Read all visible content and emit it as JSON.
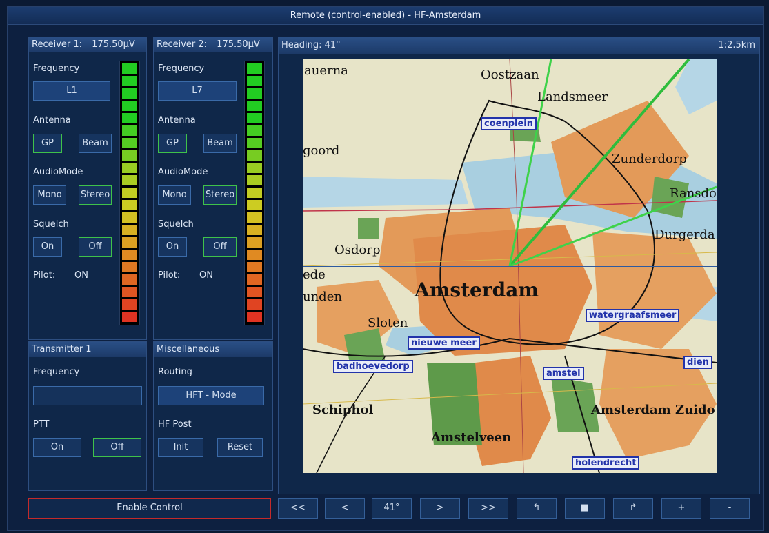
{
  "window": {
    "title": "Remote (control-enabled) - HF-Amsterdam"
  },
  "receiver1": {
    "title": "Receiver 1:",
    "level": "175.50µV",
    "frequency_label": "Frequency",
    "frequency_value": "L1",
    "antenna_label": "Antenna",
    "antenna_gp": "GP",
    "antenna_beam": "Beam",
    "audiomode_label": "AudioMode",
    "mono": "Mono",
    "stereo": "Stereo",
    "squelch_label": "Squelch",
    "squelch_on": "On",
    "squelch_off": "Off",
    "pilot_label": "Pilot:",
    "pilot_value": "ON"
  },
  "receiver2": {
    "title": "Receiver 2:",
    "level": "175.50µV",
    "frequency_label": "Frequency",
    "frequency_value": "L7",
    "antenna_label": "Antenna",
    "antenna_gp": "GP",
    "antenna_beam": "Beam",
    "audiomode_label": "AudioMode",
    "mono": "Mono",
    "stereo": "Stereo",
    "squelch_label": "Squelch",
    "squelch_on": "On",
    "squelch_off": "Off",
    "pilot_label": "Pilot:",
    "pilot_value": "ON"
  },
  "meter_colors": [
    "#22cc22",
    "#22cc22",
    "#22cc22",
    "#22cc22",
    "#22cc22",
    "#44cc22",
    "#55cc22",
    "#77cc22",
    "#99cc22",
    "#aacc22",
    "#c2cc22",
    "#cccc22",
    "#d4c022",
    "#d8b022",
    "#dca022",
    "#e08a22",
    "#e07822",
    "#e06622",
    "#e05522",
    "#e04422",
    "#e03322"
  ],
  "transmitter": {
    "title": "Transmitter 1",
    "frequency_label": "Frequency",
    "frequency_value": "",
    "ptt_label": "PTT",
    "on": "On",
    "off": "Off"
  },
  "misc": {
    "title": "Miscellaneous",
    "routing_label": "Routing",
    "routing_value": "HFT - Mode",
    "hfpost_label": "HF Post",
    "init": "Init",
    "reset": "Reset"
  },
  "map": {
    "heading": "Heading: 41°",
    "scale": "1:2.5km",
    "places": {
      "auerna": "auerna",
      "oostzaan": "Oostzaan",
      "landsmeer": "Landsmeer",
      "goord": "goord",
      "zunderdorp": "Zunderdorp",
      "ransdo": "Ransdo",
      "durgerda": "Durgerda",
      "osdorp": "Osdorp",
      "ede": "ede",
      "unden": "unden",
      "amsterdam": "Amsterdam",
      "sloten": "Sloten",
      "schiphol": "Schiphol",
      "amstelveen": "Amstelveen",
      "amsterdam_zuid": "Amsterdam Zuido"
    },
    "boxes": {
      "coenplein": "coenplein",
      "watergraafsmeer": "watergraafsmeer",
      "nieuwe_meer": "nieuwe meer",
      "badhoevedorp": "badhoevedorp",
      "amstel": "amstel",
      "dien": "dien",
      "holendrecht": "holendrecht"
    }
  },
  "controls": {
    "enable": "Enable Control",
    "fast_back": "<<",
    "back": "<",
    "heading": "41°",
    "fwd": ">",
    "fast_fwd": ">>",
    "undo": "↰",
    "stop": "■",
    "redo": "↱",
    "plus": "+",
    "minus": "-"
  }
}
